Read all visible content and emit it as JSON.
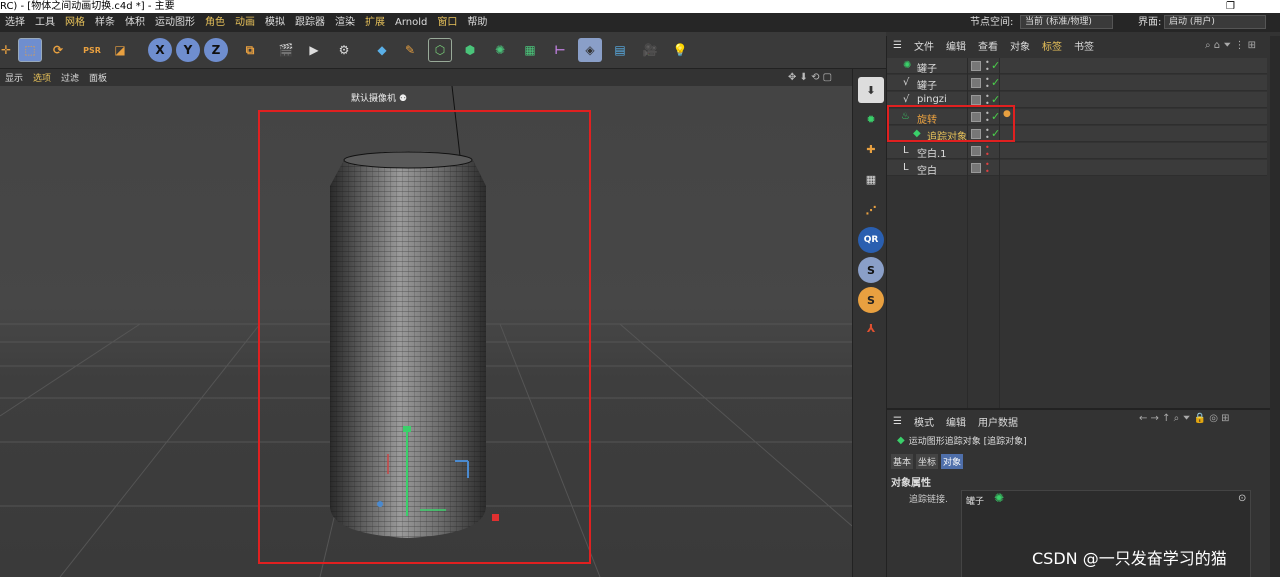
{
  "titlebar": {
    "text": "RC) - [物体之间动画切换.c4d *] - 主要"
  },
  "menubar": {
    "items": [
      "选择",
      "工具",
      "网格",
      "样条",
      "体积",
      "运动图形",
      "角色",
      "动画",
      "模拟",
      "跟踪器",
      "渲染",
      "扩展",
      "Arnold",
      "窗口",
      "帮助"
    ],
    "node_space_label": "节点空间:",
    "node_space_value": "当前 (标准/物理)",
    "interface_label": "界面:",
    "interface_value": "启动 (用户)"
  },
  "viewport_menu": {
    "items": [
      "显示",
      "选项",
      "过滤",
      "面板"
    ]
  },
  "viewport": {
    "camera_label": "默认摄像机"
  },
  "object_manager": {
    "menu": [
      "文件",
      "编辑",
      "查看",
      "对象",
      "标签",
      "书签"
    ],
    "rows": [
      {
        "name": "罐子",
        "icon": "cloner-icon"
      },
      {
        "name": "罐子",
        "icon": "spline-icon"
      },
      {
        "name": "pingzi",
        "icon": "spline-icon"
      },
      {
        "name": "旋转",
        "icon": "lathe-icon"
      },
      {
        "name": "追踪对象",
        "icon": "tracer-icon"
      },
      {
        "name": "空白.1",
        "icon": "null-icon"
      },
      {
        "name": "空白",
        "icon": "null-icon"
      }
    ]
  },
  "attribute_manager": {
    "menu": [
      "模式",
      "编辑",
      "用户数据"
    ],
    "object_title": "运动图形追踪对象 [追踪对象]",
    "tabs": [
      "基本",
      "坐标",
      "对象"
    ],
    "section_title": "对象属性",
    "field_label": "追踪链接.",
    "field_value": "罐子"
  },
  "watermark": "CSDN @一只发奋学习的猫"
}
